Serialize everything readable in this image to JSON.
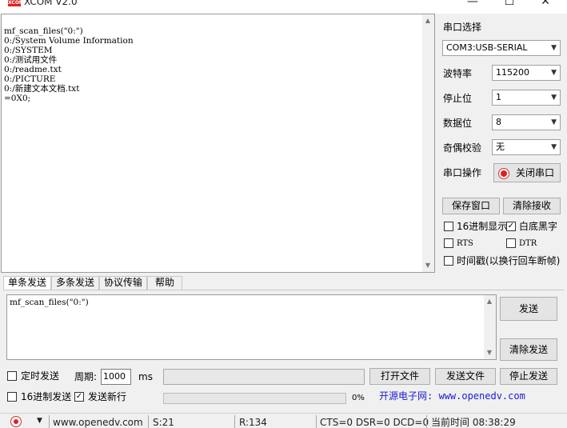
{
  "window": {
    "title": "XCOM V2.0",
    "logo_text": "XCOM",
    "minimize": "—",
    "maximize": "☐",
    "close": "✕"
  },
  "receive": {
    "lines": "mf_scan_files(\"0:\")\n0:/System Volume Information\n0:/SYSTEM\n0:/测试用文件\n0:/readme.txt\n0:/PICTURE\n0:/新建文本文档.txt\n=0X0;"
  },
  "settings": {
    "port_label": "串口选择",
    "port_value": "COM3:USB-SERIAL",
    "baud_label": "波特率",
    "baud_value": "115200",
    "stop_label": "停止位",
    "stop_value": "1",
    "data_label": "数据位",
    "data_value": "8",
    "parity_label": "奇偶校验",
    "parity_value": "无",
    "op_label": "串口操作",
    "op_button": "关闭串口",
    "save_window": "保存窗口",
    "clear_receive": "清除接收",
    "hex_display": "16进制显示",
    "white_black": "白底黑字",
    "rts": "RTS",
    "dtr": "DTR",
    "timestamp": "时间戳(以换行回车断帧)"
  },
  "tabs": [
    "单条发送",
    "多条发送",
    "协议传输",
    "帮助"
  ],
  "send": {
    "text": "mf_scan_files(\"0:\")",
    "send_button": "发送",
    "clear_send": "清除发送",
    "timed_send": "定时发送",
    "period_label": "周期:",
    "period_value": "1000",
    "period_unit": "ms",
    "open_file": "打开文件",
    "send_file": "发送文件",
    "stop_send": "停止发送",
    "hex_send": "16进制发送",
    "send_newline": "发送新行",
    "progress": "0%",
    "promo": "开源电子网: www.openedv.com"
  },
  "status": {
    "website": "www.openedv.com",
    "sent": "S:21",
    "received": "R:134",
    "lines": "CTS=0 DSR=0 DCD=0",
    "time": "当前时间 08:38:29"
  },
  "colors": {
    "promo": "#1a1ad8",
    "record_red": "#e02020"
  }
}
